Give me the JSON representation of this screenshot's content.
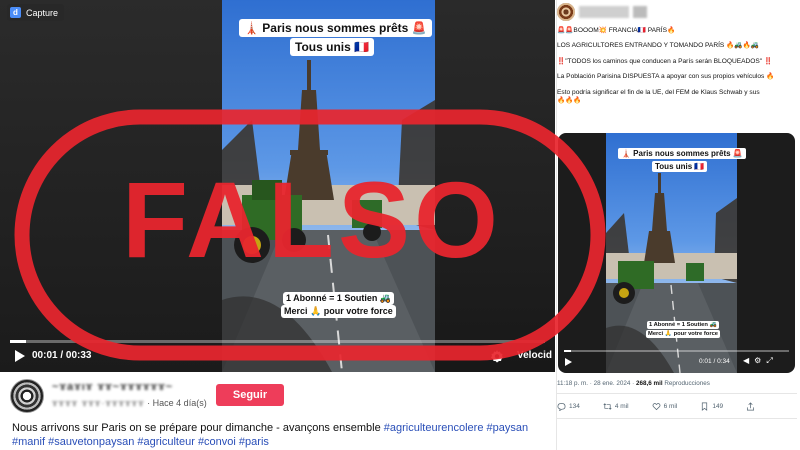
{
  "player": {
    "capture_label": "Capture",
    "caption_line1": "🗼 Paris nous sommes prêts 🚨",
    "caption_line2": "Tous unis 🇫🇷",
    "caption_line3": "1 Abonné = 1 Soutien 🚜",
    "caption_line4": "Merci 🙏 pour votre force",
    "time": "00:01 / 00:33",
    "progress_fraction": 0.03,
    "speed_label": "Velocid"
  },
  "post": {
    "author_name": "~ɤaɤıɤ ɤɤ~ɤɤɤɤɤɤ~",
    "author_handle": "ɤɤɤɤ ɤɤɤ·ɤɤɤɤɤɤ",
    "age": "· Hace 4 día(s)",
    "follow_label": "Seguir",
    "text": "Nous arrivons sur Paris on se prépare pour dimanche - avançons ensemble",
    "hashtags": [
      "#agriculteurencolere",
      "#paysan",
      "#manif",
      "#sauvetonpaysan",
      "#agriculteur",
      "#convoi",
      "#paris"
    ]
  },
  "tweet": {
    "line1": "🚨🚨BOOOM💥 FRANCIA🇫🇷 PARÍS🔥",
    "line2": "LOS AGRICULTORES ENTRANDO Y TOMANDO PARÍS 🔥🚜🔥🚜",
    "line3": "‼️\"TODOS los caminos que conducen a París serán BLOQUEADOS\" ‼️",
    "line4": "La Población Parisina DISPUESTA a apoyar con sus propios vehículos 🔥",
    "line5": "Esto podría significar el fin de la UE, del FEM de Klaus Schwab y sus",
    "line5_tail": "🔥🔥🔥",
    "embed_caption1": "🗼 Paris nous sommes prêts 🚨",
    "embed_caption2": "Tous unis 🇫🇷",
    "embed_caption3": "1 Abonné = 1 Soutien 🚜",
    "embed_caption4": "Merci 🙏 pour votre force",
    "embed_time": "0:01 / 0:34",
    "embed_progress_fraction": 0.03,
    "timestamp": "11:18 p. m. · 28 ene. 2024 · ",
    "views": "268,6 mil",
    "views_label": " Reproducciones",
    "replies": "134",
    "retweets": "4 mil",
    "likes": "6 mil",
    "bookmarks": "149"
  },
  "stamp": {
    "text": "FALSO",
    "color": "#e8262e"
  },
  "colors": {
    "follow": "#ee3d5a",
    "hashtag": "#2a4fb8",
    "stamp": "#e8262e"
  }
}
